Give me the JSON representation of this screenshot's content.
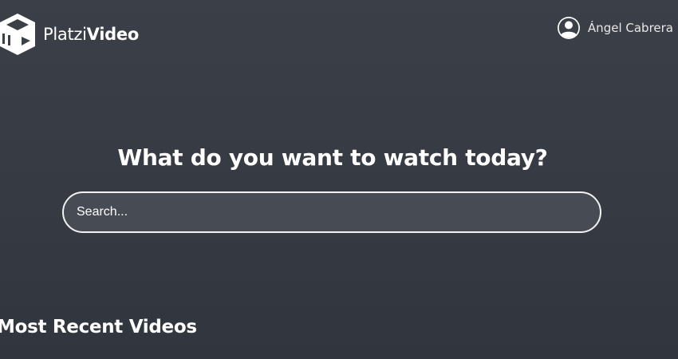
{
  "header": {
    "brand": {
      "name_part_1": "Platzi",
      "name_part_2": "Video",
      "logo_icon": "play-cube-icon"
    },
    "user": {
      "name": "Ángel Cabrera",
      "avatar_icon": "user-avatar-icon"
    }
  },
  "hero": {
    "title": "What do you want to watch today?",
    "search": {
      "placeholder": "Search...",
      "value": ""
    }
  },
  "sections": {
    "recent": {
      "title": "Most Recent Videos"
    }
  },
  "colors": {
    "background": "#3b3f47",
    "search_background": "#474b53",
    "search_border": "#f2f2f2",
    "text": "#ffffff"
  }
}
